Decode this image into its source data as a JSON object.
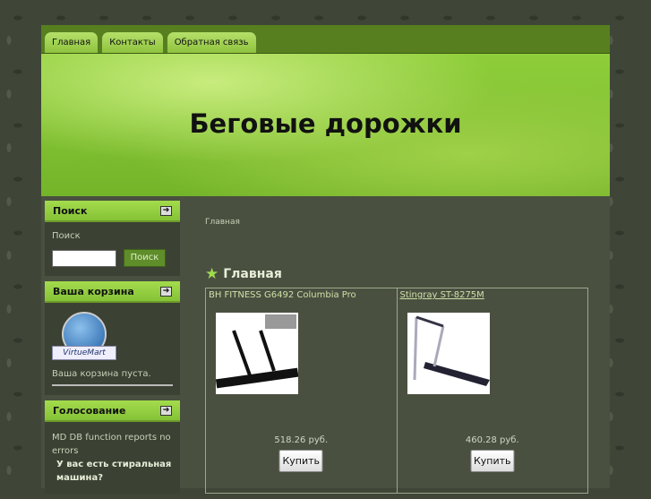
{
  "nav": {
    "tabs": [
      "Главная",
      "Контакты",
      "Обратная связь"
    ]
  },
  "header": {
    "title": "Беговые дорожки"
  },
  "search": {
    "title": "Поиск",
    "label": "Поиск",
    "value": "",
    "button": "Поиск"
  },
  "cart": {
    "title": "Ваша корзина",
    "logo_text": "VirtueMart",
    "empty": "Ваша корзина пуста."
  },
  "poll": {
    "title": "Голосование",
    "error": "MD DB function reports no errors",
    "question": "У вас есть стиральная машина?"
  },
  "main": {
    "breadcrumb": "Главная",
    "title": "Главная",
    "products": [
      {
        "name": "BH FITNESS G6492 Columbia Pro",
        "price": "518.26 руб.",
        "buy": "Купить",
        "link": false
      },
      {
        "name": "Stingray ST-8275M",
        "price": "460.28 руб.",
        "buy": "Купить",
        "link": true
      }
    ]
  }
}
